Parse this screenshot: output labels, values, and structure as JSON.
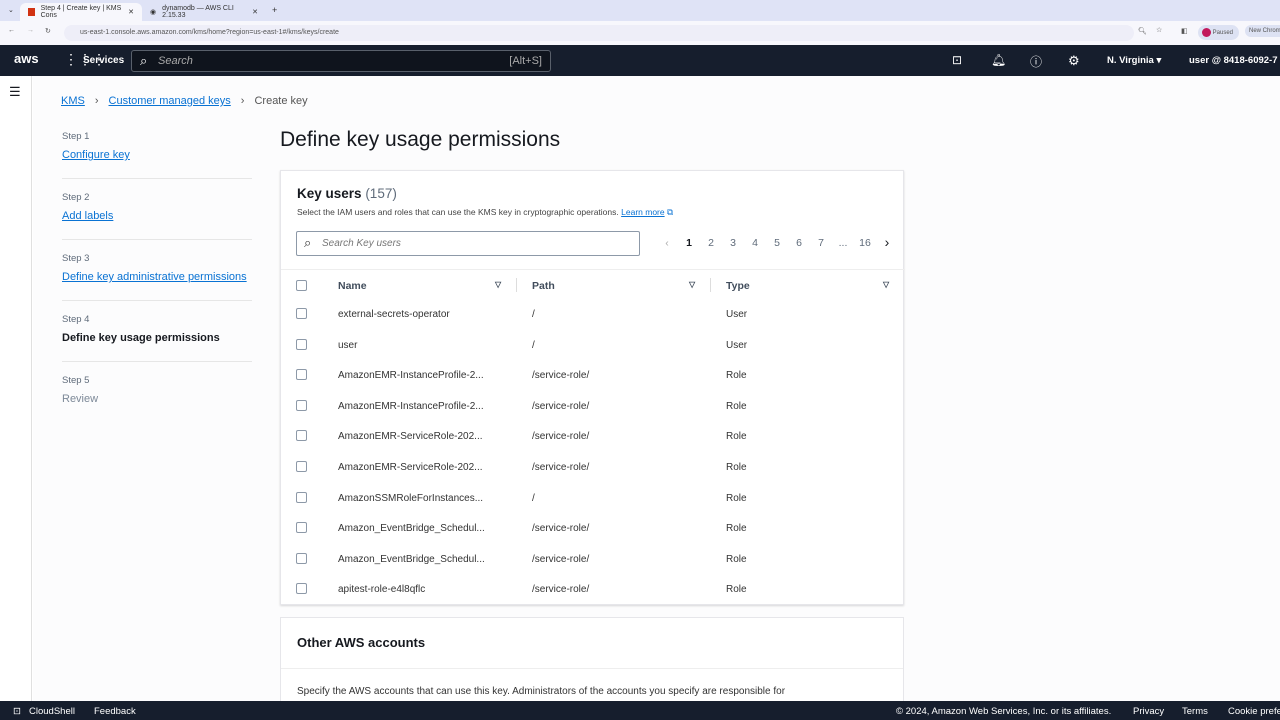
{
  "browser": {
    "tabs": [
      {
        "label": "Step 4 | Create key | KMS Cons"
      },
      {
        "label": "dynamodb — AWS CLI 2.15.33"
      }
    ],
    "url": "us-east-1.console.aws.amazon.com/kms/home?region=us-east-1#/kms/keys/create",
    "profile": "Paused",
    "new_chrome": "New Chrome"
  },
  "nav": {
    "logo": "aws",
    "services": "Services",
    "search_placeholder": "Search",
    "search_shortcut": "[Alt+S]",
    "region": "N. Virginia ▾",
    "account": "user @ 8418-6092-7"
  },
  "breadcrumb": [
    "KMS",
    "Customer managed keys",
    "Create key"
  ],
  "steps": [
    {
      "step": "Step 1",
      "label": "Configure key",
      "link": true
    },
    {
      "step": "Step 2",
      "label": "Add labels",
      "link": true
    },
    {
      "step": "Step 3",
      "label": "Define key administrative permissions",
      "link": true
    },
    {
      "step": "Step 4",
      "label": "Define key usage permissions",
      "link": false
    },
    {
      "step": "Step 5",
      "label": "Review",
      "link": false
    }
  ],
  "page_title": "Define key usage permissions",
  "key_users": {
    "title": "Key users",
    "count": "(157)",
    "description": "Select the IAM users and roles that can use the KMS key in cryptographic operations.",
    "learn_more": "Learn more",
    "search_placeholder": "Search Key users",
    "pages": [
      "1",
      "2",
      "3",
      "4",
      "5",
      "6",
      "7",
      "...",
      "16"
    ],
    "columns": [
      "Name",
      "Path",
      "Type"
    ],
    "rows": [
      [
        "external-secrets-operator",
        "/",
        "User"
      ],
      [
        "user",
        "/",
        "User"
      ],
      [
        "AmazonEMR-InstanceProfile-2...",
        "/service-role/",
        "Role"
      ],
      [
        "AmazonEMR-InstanceProfile-2...",
        "/service-role/",
        "Role"
      ],
      [
        "AmazonEMR-ServiceRole-202...",
        "/service-role/",
        "Role"
      ],
      [
        "AmazonEMR-ServiceRole-202...",
        "/service-role/",
        "Role"
      ],
      [
        "AmazonSSMRoleForInstances...",
        "/",
        "Role"
      ],
      [
        "Amazon_EventBridge_Schedul...",
        "/service-role/",
        "Role"
      ],
      [
        "Amazon_EventBridge_Schedul...",
        "/service-role/",
        "Role"
      ],
      [
        "apitest-role-e4l8qflc",
        "/service-role/",
        "Role"
      ]
    ]
  },
  "other_accounts": {
    "title": "Other AWS accounts",
    "description": "Specify the AWS accounts that can use this key. Administrators of the accounts you specify are responsible for"
  },
  "footer": {
    "cloudshell": "CloudShell",
    "feedback": "Feedback",
    "copyright": "© 2024, Amazon Web Services, Inc. or its affiliates.",
    "privacy": "Privacy",
    "terms": "Terms",
    "cookie": "Cookie prefe"
  }
}
